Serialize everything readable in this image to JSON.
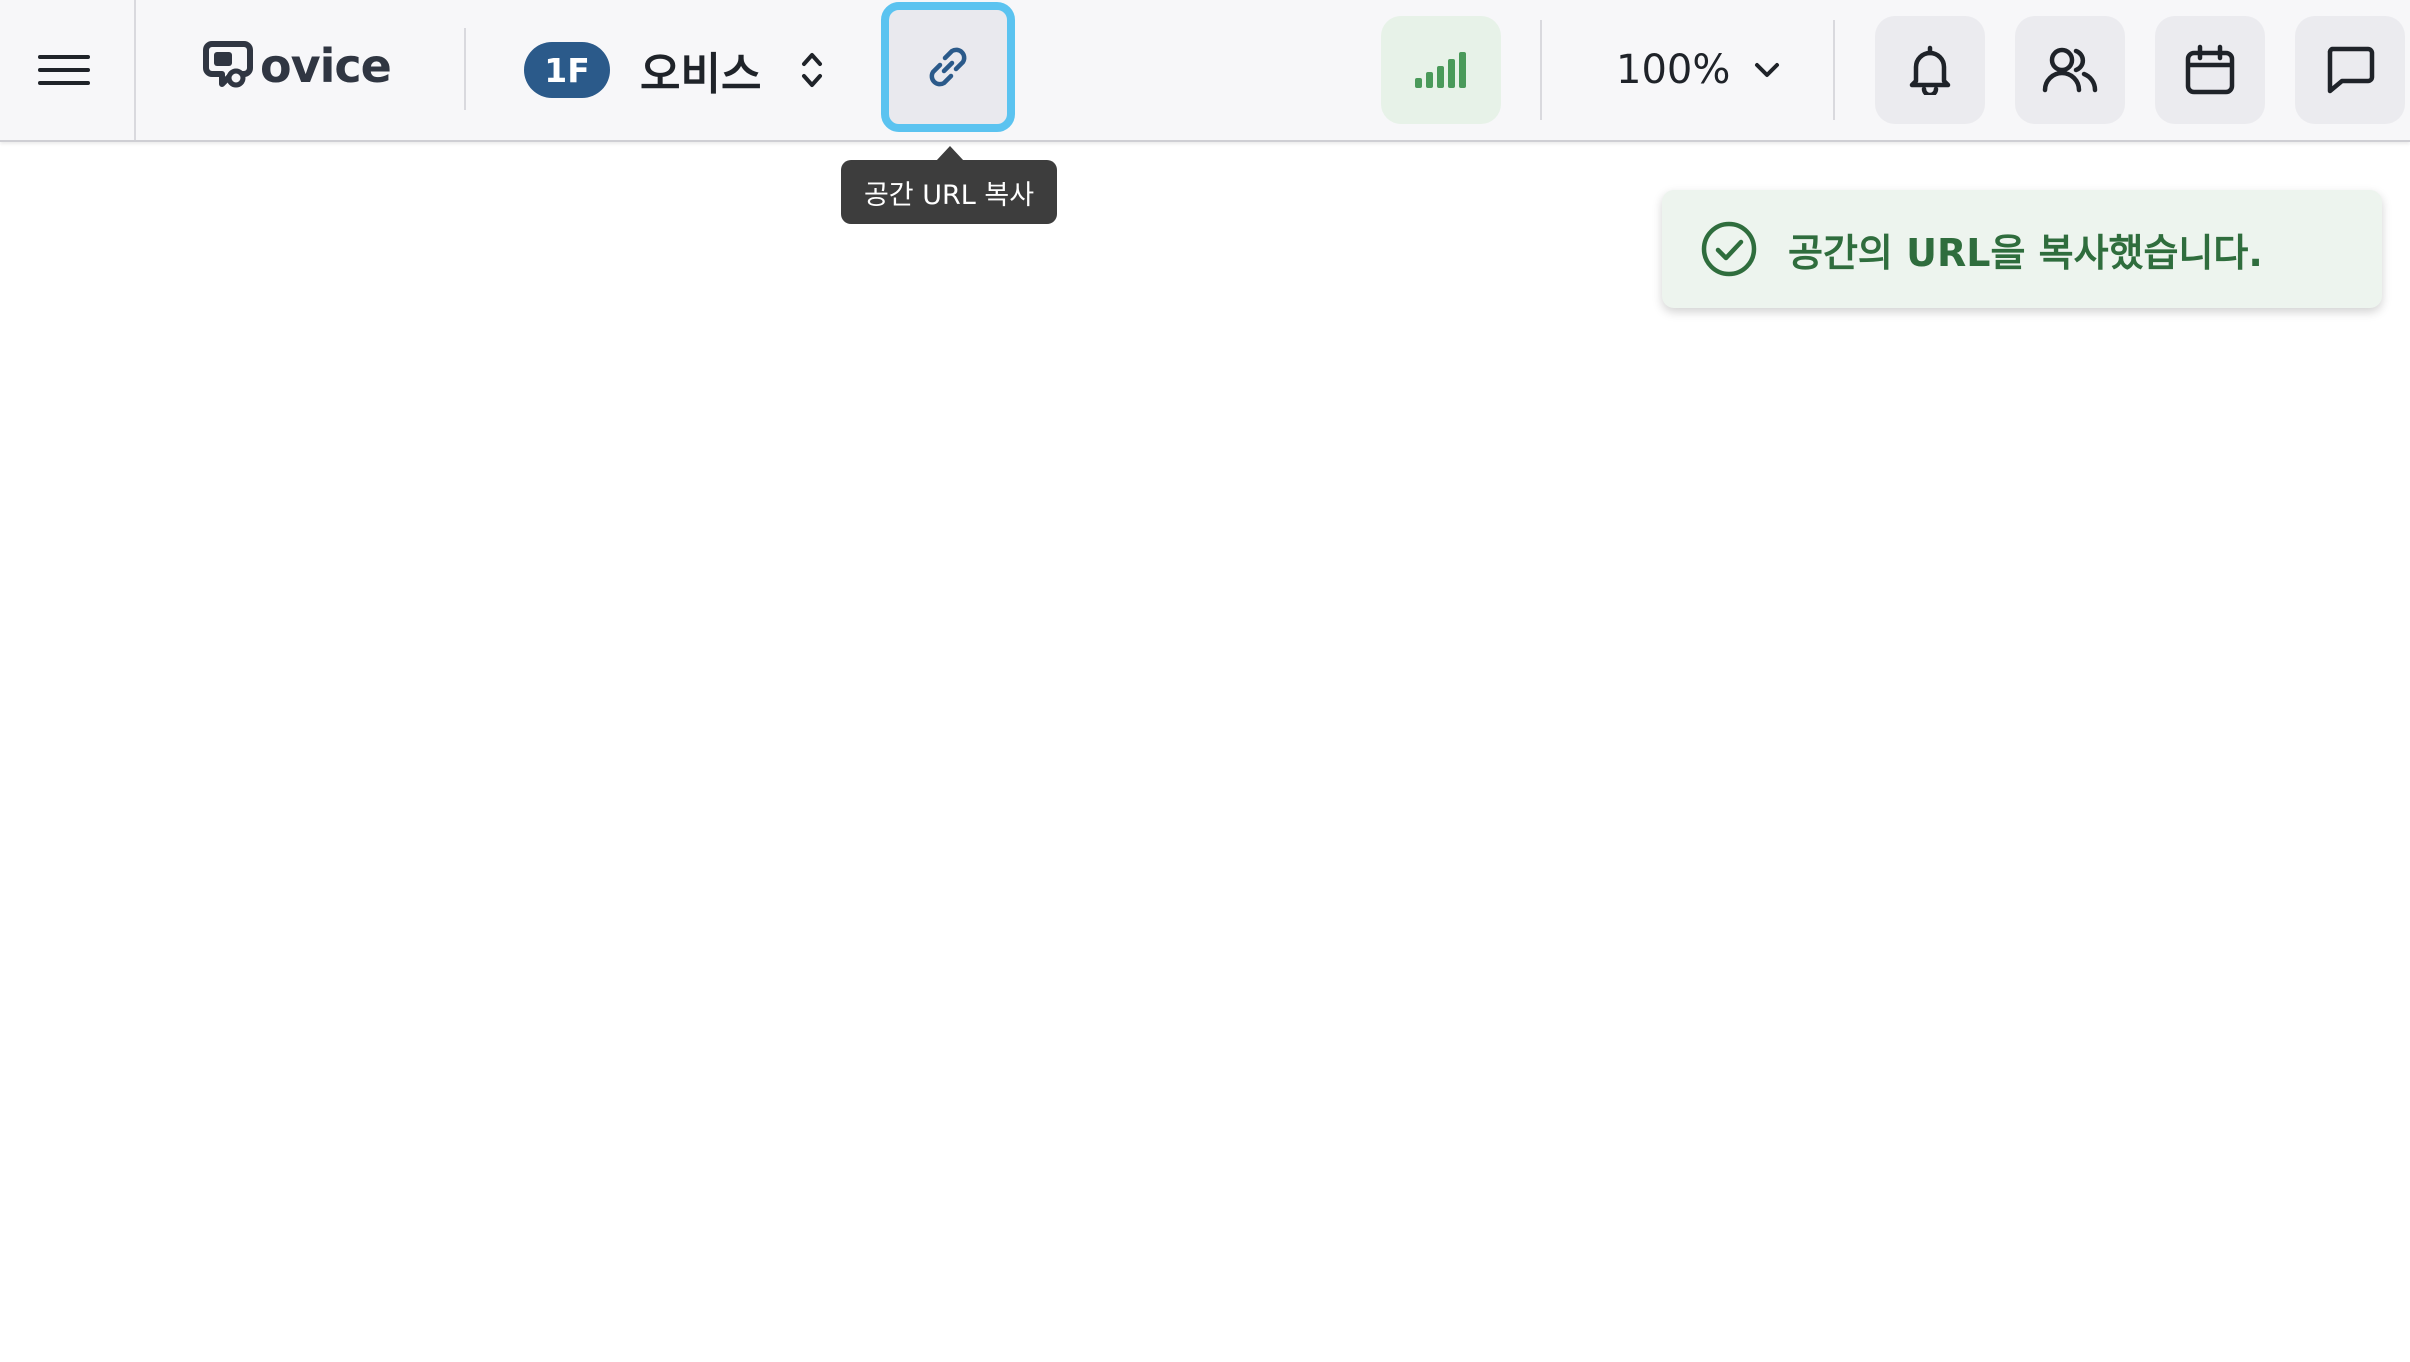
{
  "header": {
    "logo_text": "ovice",
    "floor": {
      "badge": "1F",
      "name": "오비스"
    },
    "copy_link": {
      "tooltip": "공간 URL 복사"
    },
    "zoom": {
      "value": "100%"
    },
    "icons": {
      "menu": "hamburger-icon",
      "link": "link-icon",
      "network": "signal-bars-icon",
      "notifications": "bell-icon",
      "members": "users-icon",
      "calendar": "calendar-icon",
      "chat": "chat-icon"
    }
  },
  "toast": {
    "message": "공간의 URL을 복사했습니다."
  },
  "colors": {
    "accent_blue": "#2b5a8a",
    "focus_ring": "#5bc3f0",
    "success_green": "#2f6d3d",
    "signal_green": "#4a9a5a",
    "toast_bg": "#edf4ee"
  }
}
